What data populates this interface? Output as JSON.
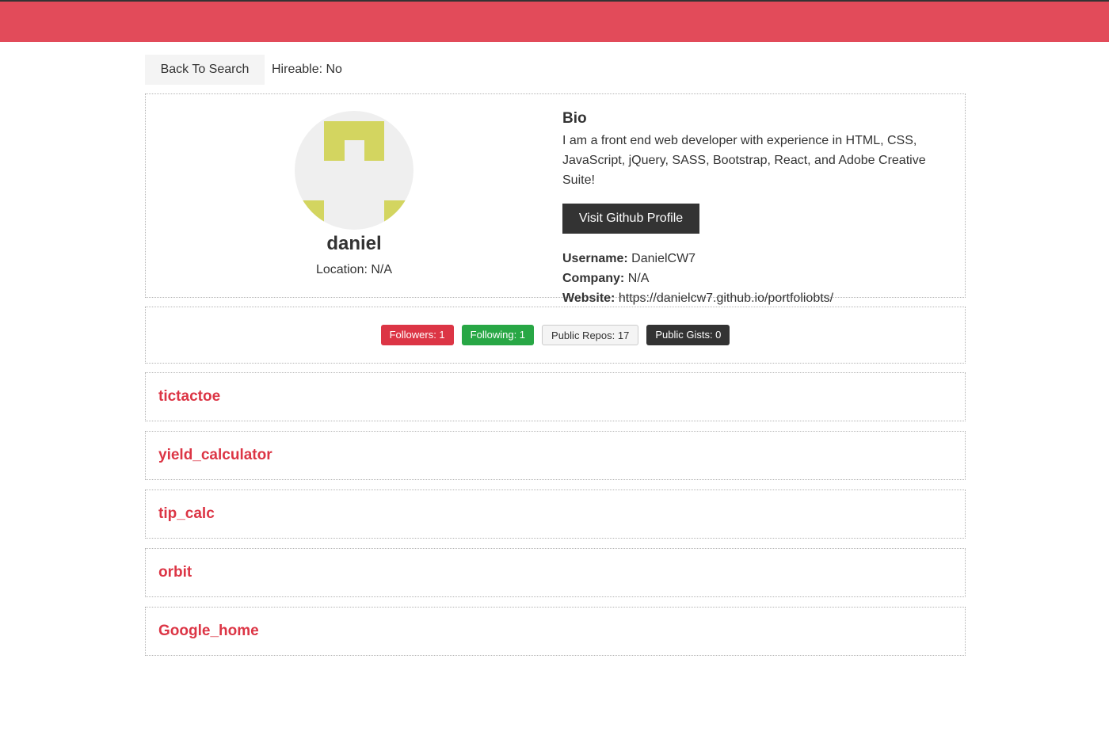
{
  "header": {
    "bar_color": "#e24b5a"
  },
  "toolbar": {
    "back_label": "Back To Search",
    "hireable_text": "Hireable: No"
  },
  "profile": {
    "name": "daniel",
    "location": "Location: N/A",
    "avatar_icon": "identicon-avatar",
    "bio_heading": "Bio",
    "bio_text": "I am a front end web developer with experience in HTML, CSS, JavaScript, jQuery, SASS, Bootstrap, React, and Adobe Creative Suite!",
    "github_button_label": "Visit Github Profile",
    "username_label": "Username:",
    "username_value": "DanielCW7",
    "company_label": "Company:",
    "company_value": "N/A",
    "website_label": "Website:",
    "website_value": "https://danielcw7.github.io/portfoliobts/"
  },
  "stats": {
    "followers": "Followers: 1",
    "following": "Following: 1",
    "public_repos": "Public Repos: 17",
    "public_gists": "Public Gists: 0"
  },
  "repos": [
    {
      "name": "tictactoe"
    },
    {
      "name": "yield_calculator"
    },
    {
      "name": "tip_calc"
    },
    {
      "name": "orbit"
    },
    {
      "name": "Google_home"
    }
  ],
  "colors": {
    "accent": "#dc3545",
    "success": "#28a745",
    "dark": "#333333",
    "identicon": "#d3d560"
  }
}
